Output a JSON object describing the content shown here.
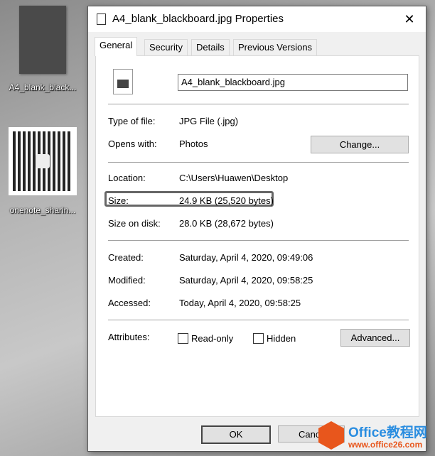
{
  "desktop": {
    "icons": [
      {
        "label": "A4_blank_black..."
      },
      {
        "label": "onenote_sharin..."
      }
    ]
  },
  "dialog": {
    "title": "A4_blank_blackboard.jpg Properties",
    "close": "✕",
    "tabs": [
      "General",
      "Security",
      "Details",
      "Previous Versions"
    ],
    "filename": "A4_blank_blackboard.jpg",
    "rows": {
      "type": {
        "label": "Type of file:",
        "value": "JPG File (.jpg)"
      },
      "opens": {
        "label": "Opens with:",
        "value": "Photos"
      },
      "location": {
        "label": "Location:",
        "value": "C:\\Users\\Huawen\\Desktop"
      },
      "size": {
        "label": "Size:",
        "value": "24.9 KB (25,520 bytes)"
      },
      "disk": {
        "label": "Size on disk:",
        "value": "28.0 KB (28,672 bytes)"
      },
      "created": {
        "label": "Created:",
        "value": "Saturday, April 4, 2020, 09:49:06"
      },
      "modified": {
        "label": "Modified:",
        "value": "Saturday, April 4, 2020, 09:58:25"
      },
      "accessed": {
        "label": "Accessed:",
        "value": "Today, April 4, 2020, 09:58:25"
      }
    },
    "attributes_label": "Attributes:",
    "readonly": "Read-only",
    "hidden": "Hidden",
    "change": "Change...",
    "advanced": "Advanced...",
    "ok": "OK",
    "cancel": "Cancel"
  },
  "watermark": {
    "title": "Office教程网",
    "url": "www.office26.com"
  }
}
